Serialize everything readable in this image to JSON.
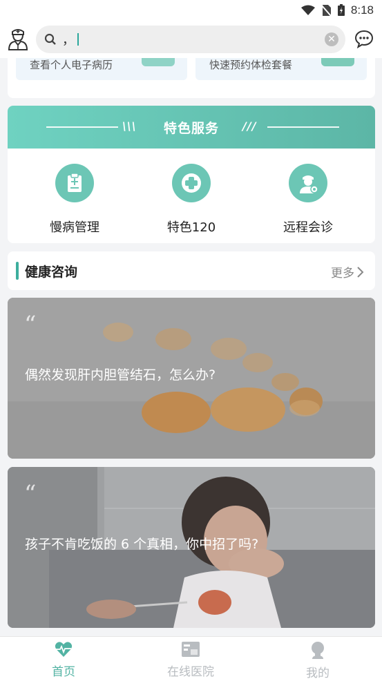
{
  "status": {
    "time": "8:18"
  },
  "search": {
    "value": "，"
  },
  "quick": [
    {
      "label": "查看个人电子病历"
    },
    {
      "label": "快速预约体检套餐"
    }
  ],
  "feature": {
    "title": "特色服务",
    "items": [
      {
        "label": "慢病管理",
        "icon": "clipboard-icon"
      },
      {
        "label": "特色120",
        "icon": "medical-cross-icon"
      },
      {
        "label": "远程会诊",
        "icon": "doctor-icon"
      }
    ]
  },
  "section": {
    "title": "健康咨询",
    "more": "更多"
  },
  "articles": [
    {
      "title": "偶然发现肝内胆管结石，怎么办?"
    },
    {
      "title": "孩子不肯吃饭的 6 个真相，你中招了吗?"
    }
  ],
  "tabs": [
    {
      "label": "首页",
      "icon": "heartbeat-icon",
      "active": true
    },
    {
      "label": "在线医院",
      "icon": "hospital-card-icon",
      "active": false
    },
    {
      "label": "我的",
      "icon": "profile-icon",
      "active": false
    }
  ],
  "colors": {
    "accent": "#5cb6a6",
    "tab_active": "#52b3a3",
    "tab_inactive": "#b8bcc0"
  }
}
